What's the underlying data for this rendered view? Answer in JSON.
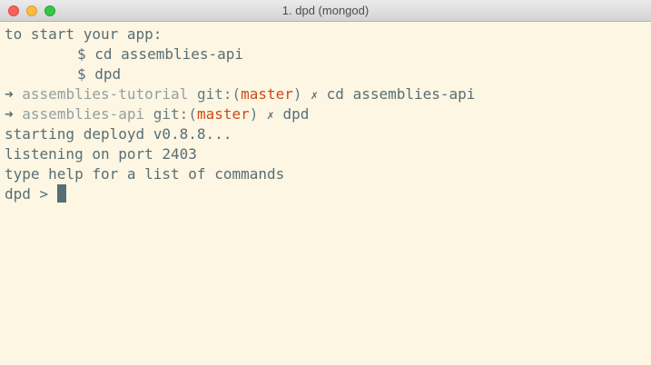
{
  "window": {
    "title": "1. dpd (mongod)"
  },
  "terminal": {
    "lines": [
      {
        "text": "to start your app:"
      },
      {
        "indent": true,
        "text": "$ cd assemblies-api"
      },
      {
        "indent": true,
        "text": "$ dpd"
      },
      {
        "prompt": {
          "arrow": "➜",
          "dir": "assemblies-tutorial",
          "git_prefix": "git:(",
          "branch": "master",
          "git_suffix": ")",
          "dirty_mark": "✗",
          "command": "cd assemblies-api"
        }
      },
      {
        "prompt": {
          "arrow": "➜",
          "dir": "assemblies-api",
          "git_prefix": "git:(",
          "branch": "master",
          "git_suffix": ")",
          "dirty_mark": "✗",
          "command": "dpd"
        }
      },
      {
        "text": "starting deployd v0.8.8..."
      },
      {
        "text": "listening on port 2403"
      },
      {
        "text": "type help for a list of commands"
      },
      {
        "text": "dpd > "
      }
    ]
  },
  "colors": {
    "background": "#fdf6e3",
    "foreground": "#586e75",
    "directory": "#93a1a1",
    "branch": "#cb4b16"
  }
}
